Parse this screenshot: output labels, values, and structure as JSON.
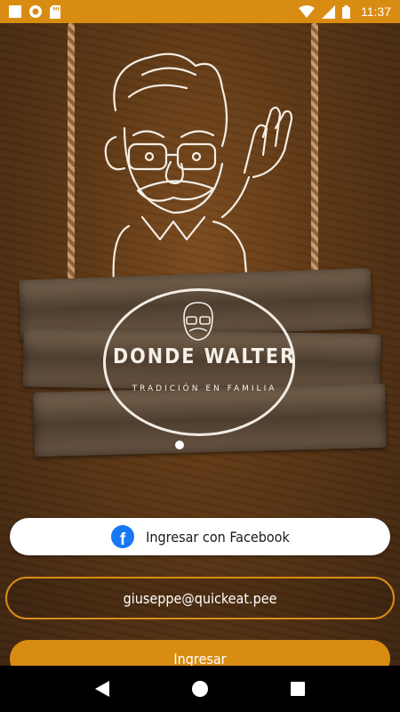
{
  "status_bar": {
    "time": "11:37",
    "icons": [
      "square-icon",
      "record-icon",
      "sd-card-icon",
      "wifi-icon",
      "signal-icon",
      "battery-icon"
    ],
    "background": "#d98c12"
  },
  "logo": {
    "title": "DONDE WALTER",
    "subtitle": "TRADICIÓN EN FAMILIA"
  },
  "carousel": {
    "page_count_shown": 1,
    "active_index": 0
  },
  "facebook_button": {
    "label": "Ingresar con Facebook",
    "icon": "facebook-icon",
    "icon_color": "#1877f2"
  },
  "email_input": {
    "value": "giuseppe@quickeat.pee",
    "placeholder": ""
  },
  "login_button": {
    "label": "Ingresar",
    "background": "#d98c12"
  },
  "nav_bar": {
    "items": [
      "back-icon",
      "home-icon",
      "recents-icon"
    ]
  }
}
